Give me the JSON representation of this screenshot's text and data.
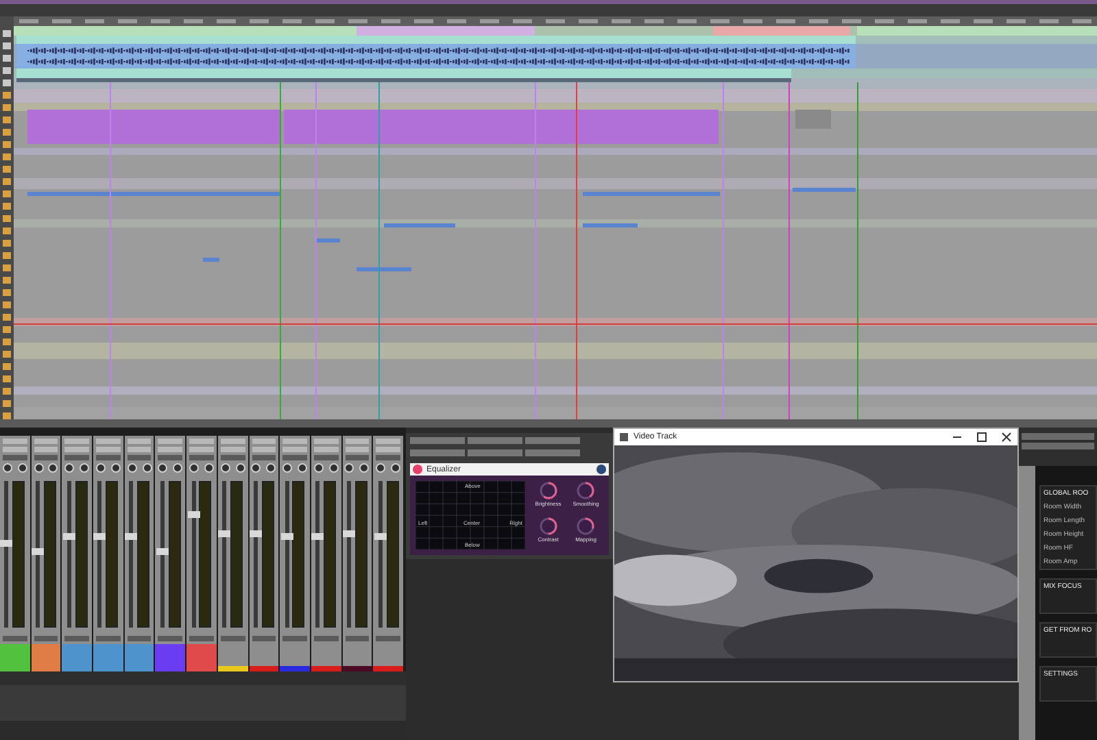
{
  "mixer": {
    "channels": [
      {
        "kind": "block",
        "color": "#52c23c",
        "level": 0.55
      },
      {
        "kind": "block",
        "color": "#e07c45",
        "level": 0.5
      },
      {
        "kind": "block",
        "color": "#4f93cc",
        "level": 0.6
      },
      {
        "kind": "block",
        "color": "#4f93cc",
        "level": 0.6
      },
      {
        "kind": "block",
        "color": "#4f93cc",
        "level": 0.6
      },
      {
        "kind": "block",
        "color": "#6a3cf2",
        "level": 0.5
      },
      {
        "kind": "block",
        "color": "#e04a4a",
        "level": 0.75
      },
      {
        "kind": "stripe",
        "color": "#e8c81c",
        "level": 0.62
      },
      {
        "kind": "stripe",
        "color": "#d81c1c",
        "level": 0.62
      },
      {
        "kind": "stripe",
        "color": "#2a2ae0",
        "level": 0.6
      },
      {
        "kind": "stripe",
        "color": "#d81c1c",
        "level": 0.6
      },
      {
        "kind": "stripe",
        "color": "#4a0c24",
        "level": 0.62
      },
      {
        "kind": "stripe",
        "color": "#d81c1c",
        "level": 0.6
      }
    ]
  },
  "plugin": {
    "title": "Equalizer",
    "pad": {
      "labels": [
        {
          "kind": "top",
          "text": "Above"
        },
        {
          "kind": "left",
          "text": "Left"
        },
        {
          "kind": "center",
          "text": "Center"
        },
        {
          "kind": "right",
          "text": "Right"
        },
        {
          "kind": "bottom",
          "text": "Below"
        }
      ]
    },
    "knobs": [
      {
        "label": "Brightness",
        "level": 0.6
      },
      {
        "label": "Smoothing",
        "level": 0.4
      },
      {
        "label": "Contrast",
        "level": 0.5
      },
      {
        "label": "Mapping",
        "level": 0.3
      }
    ]
  },
  "video_window": {
    "title": "Video Track"
  },
  "room_panel": {
    "sections": [
      {
        "heading": "GLOBAL ROO",
        "items": [
          "Room Width",
          "Room Length",
          "Room Height",
          "Room HF",
          "Room Amp"
        ]
      },
      {
        "heading": "MIX FOCUS"
      },
      {
        "heading": "GET FROM RO"
      },
      {
        "heading": "SETTINGS"
      }
    ]
  }
}
